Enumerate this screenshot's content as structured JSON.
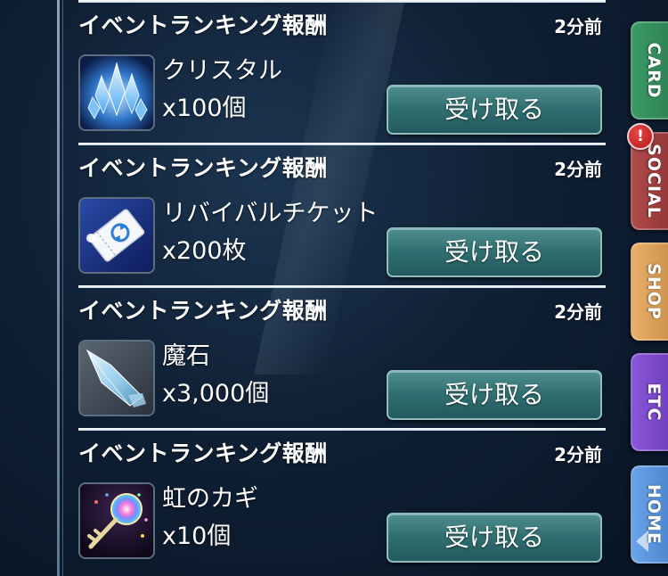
{
  "rewards": [
    {
      "title": "イベントランキング報酬",
      "time": "2分前",
      "item_name": "クリスタル",
      "quantity": "x100個",
      "button_label": "受け取る",
      "icon": "crystal-icon"
    },
    {
      "title": "イベントランキング報酬",
      "time": "2分前",
      "item_name": "リバイバルチケット",
      "quantity": "x200枚",
      "button_label": "受け取る",
      "icon": "revival-ticket-icon"
    },
    {
      "title": "イベントランキング報酬",
      "time": "2分前",
      "item_name": "魔石",
      "quantity": "x3,000個",
      "button_label": "受け取る",
      "icon": "magic-stone-icon"
    },
    {
      "title": "イベントランキング報酬",
      "time": "2分前",
      "item_name": "虹のカギ",
      "quantity": "x10個",
      "button_label": "受け取る",
      "icon": "rainbow-key-icon"
    }
  ],
  "side_tabs": {
    "card": "CARD",
    "social": "SOCIAL",
    "shop": "SHOP",
    "etc": "ETC",
    "home": "HOME"
  },
  "social_badge": "!",
  "colors": {
    "button": "#2f6e70",
    "tab_card": "#3b9a64",
    "tab_social": "#b04a4a",
    "tab_shop": "#e9b06b",
    "tab_etc": "#8a56d8",
    "tab_home": "#6aa3e8"
  }
}
